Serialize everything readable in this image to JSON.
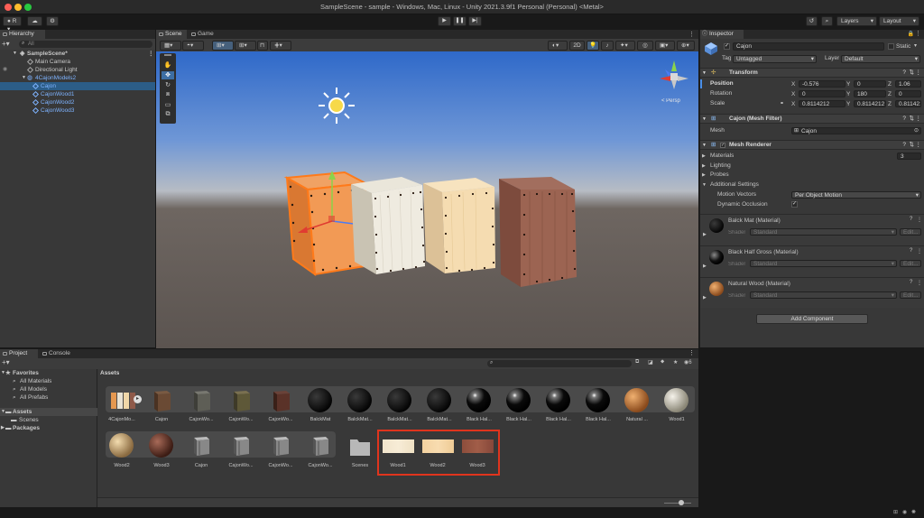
{
  "window": {
    "title": "SampleScene - sample - Windows, Mac, Linux - Unity 2021.3.9f1 Personal (Personal) <Metal>"
  },
  "toolbar": {
    "account": "R",
    "layers": "Layers",
    "layout": "Layout"
  },
  "hierarchy": {
    "tab": "Hierarchy",
    "search": "All",
    "items": [
      {
        "label": "SampleScene*"
      },
      {
        "label": "Main Camera"
      },
      {
        "label": "Directional Light"
      },
      {
        "label": "4CajonModels2"
      },
      {
        "label": "Cajon"
      },
      {
        "label": "CajonWood1"
      },
      {
        "label": "CajonWood2"
      },
      {
        "label": "CajonWood3"
      }
    ]
  },
  "scene": {
    "tabs": [
      "Scene",
      "Game"
    ],
    "mode2d": "2D",
    "persp": "< Persp"
  },
  "inspector": {
    "tab": "Inspector",
    "object_name": "Cajon",
    "static_label": "Static",
    "tag_label": "Tag",
    "tag_value": "Untagged",
    "layer_label": "Layer",
    "layer_value": "Default",
    "transform": {
      "title": "Transform",
      "position_label": "Position",
      "rotation_label": "Rotation",
      "scale_label": "Scale",
      "position": [
        "-0.576",
        "0",
        "1.06"
      ],
      "rotation": [
        "0",
        "180",
        "0"
      ],
      "scale": [
        "0.8114212",
        "0.8114212",
        "0.8114212"
      ]
    },
    "mesh_filter": {
      "title": "Cajon (Mesh Filter)",
      "mesh_label": "Mesh",
      "mesh_value": "Cajon"
    },
    "mesh_renderer": {
      "title": "Mesh Renderer",
      "materials_label": "Materials",
      "materials_count": "3",
      "lighting": "Lighting",
      "probes": "Probes",
      "additional": "Additional Settings",
      "motion_label": "Motion Vectors",
      "motion_value": "Per Object Motion",
      "occlusion_label": "Dynamic Occlusion"
    },
    "materials": [
      {
        "name": "Balck Mat (Material)",
        "shader_label": "Shader",
        "shader": "Standard",
        "edit": "Edit..."
      },
      {
        "name": "Black Half Gross (Material)",
        "shader_label": "Shader",
        "shader": "Standard",
        "edit": "Edit..."
      },
      {
        "name": "Natural Wood (Material)",
        "shader_label": "Shader",
        "shader": "Standard",
        "edit": "Edit..."
      }
    ],
    "add_component": "Add Component"
  },
  "project": {
    "tabs": [
      "Project",
      "Console"
    ],
    "favorites": "Favorites",
    "favorites_items": [
      "All Materials",
      "All Models",
      "All Prefabs"
    ],
    "assets_tree": "Assets",
    "scenes_tree": "Scenes",
    "packages_tree": "Packages",
    "breadcrumb": "Assets",
    "hidden_count": "6",
    "row1": [
      "4CajonMo...",
      "Cajon",
      "CajonWo...",
      "CajonWo...",
      "CajonWo...",
      "BalckMat",
      "BalckMat...",
      "BalckMat...",
      "BalckMat...",
      "Black Hal...",
      "Black Hal...",
      "Black Hal...",
      "Black Hal...",
      "Natural ...",
      "Wood1"
    ],
    "row2": [
      "Wood2",
      "Wood3",
      "Cajon",
      "CajonWo...",
      "CajonWo...",
      "CajonWo...",
      "Scenes",
      "Wood1",
      "Wood2",
      "Wood3"
    ]
  },
  "colors": {
    "highlight_box": "#e0341d",
    "selection": "#2c5d87",
    "accent_blue": "#7eb3ff"
  }
}
